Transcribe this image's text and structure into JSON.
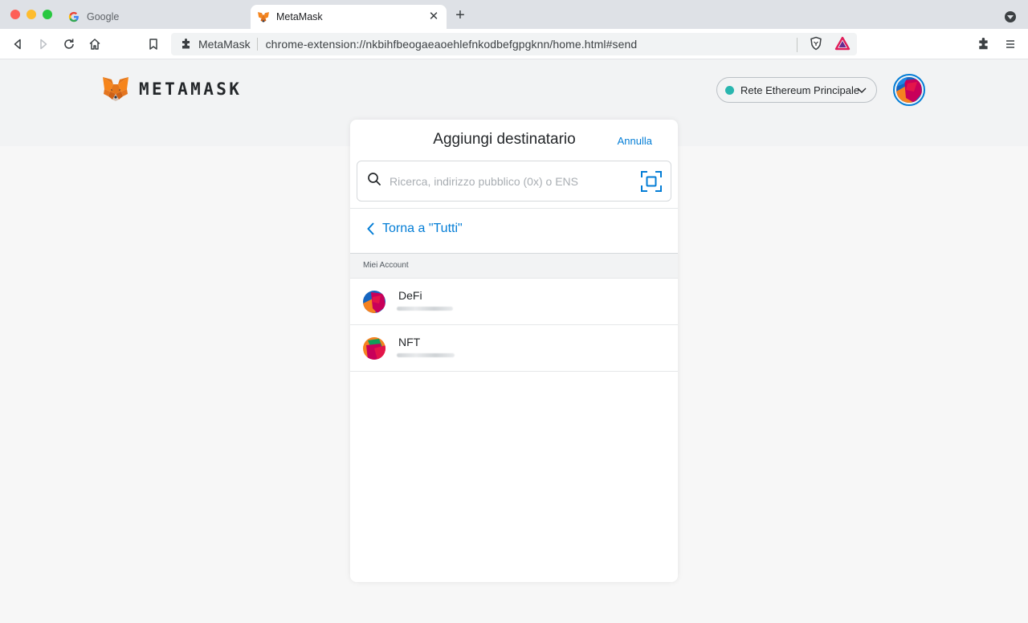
{
  "browser": {
    "tabs": [
      {
        "title": "Google",
        "active": false,
        "favicon": "google-icon"
      },
      {
        "title": "MetaMask",
        "active": true,
        "favicon": "metamask-fox-icon"
      }
    ],
    "address_bar": {
      "extension_name": "MetaMask",
      "url": "chrome-extension://nkbihfbeogaeaoehlefnkodbefgpgknn/home.html#send"
    }
  },
  "app": {
    "brand": "METAMASK",
    "network": {
      "label": "Rete Ethereum Principale",
      "status_color": "#29b6af"
    },
    "accent_color": "#037dd6"
  },
  "send": {
    "title": "Aggiungi destinatario",
    "cancel_label": "Annulla",
    "search_placeholder": "Ricerca, indirizzo pubblico (0x) o ENS",
    "back_label": "Torna a \"Tutti\"",
    "section_label": "Miei Account",
    "accounts": [
      {
        "name": "DeFi"
      },
      {
        "name": "NFT"
      }
    ]
  }
}
